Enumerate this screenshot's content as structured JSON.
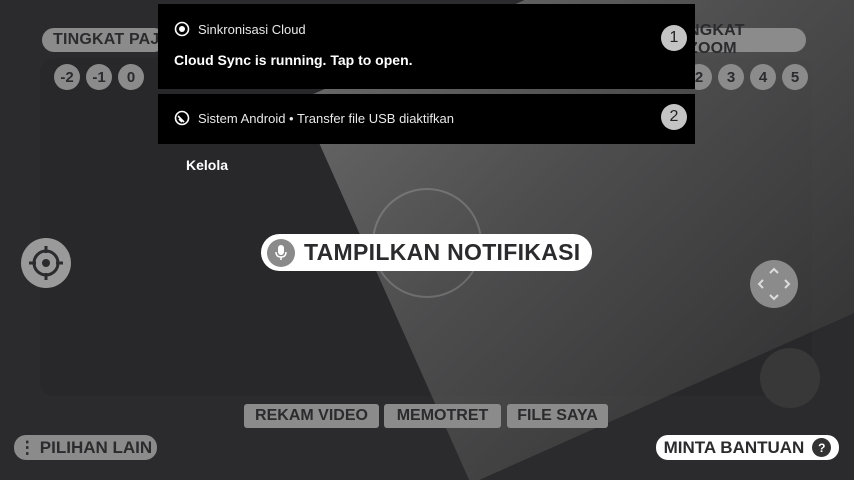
{
  "top": {
    "left_label": "TINGKAT PAJ",
    "right_label": "NGKAT ZOOM",
    "left_levels": [
      "-2",
      "-1",
      "0"
    ],
    "right_levels": [
      "2",
      "3",
      "4",
      "5"
    ]
  },
  "notifications": [
    {
      "app": "Sinkronisasi Cloud",
      "title": "Cloud Sync is running. Tap to open.",
      "badge": "1"
    },
    {
      "app": "Sistem Android • Transfer file USB diaktifkan",
      "badge": "2"
    }
  ],
  "manage_label": "Kelola",
  "voice_label": "TAMPILKAN NOTIFIKASI",
  "tabs": {
    "record": "REKAM VIDEO",
    "photo": "MEMOTRET",
    "files": "FILE SAYA"
  },
  "more_label": "PILIHAN LAIN",
  "more_icon": "⋮",
  "help_label": "MINTA BANTUAN",
  "help_icon": "?",
  "colors": {
    "pill": "#8b8b8b",
    "background": "#2b2b2d",
    "notification": "#000000",
    "badge": "#c4c4c4"
  }
}
